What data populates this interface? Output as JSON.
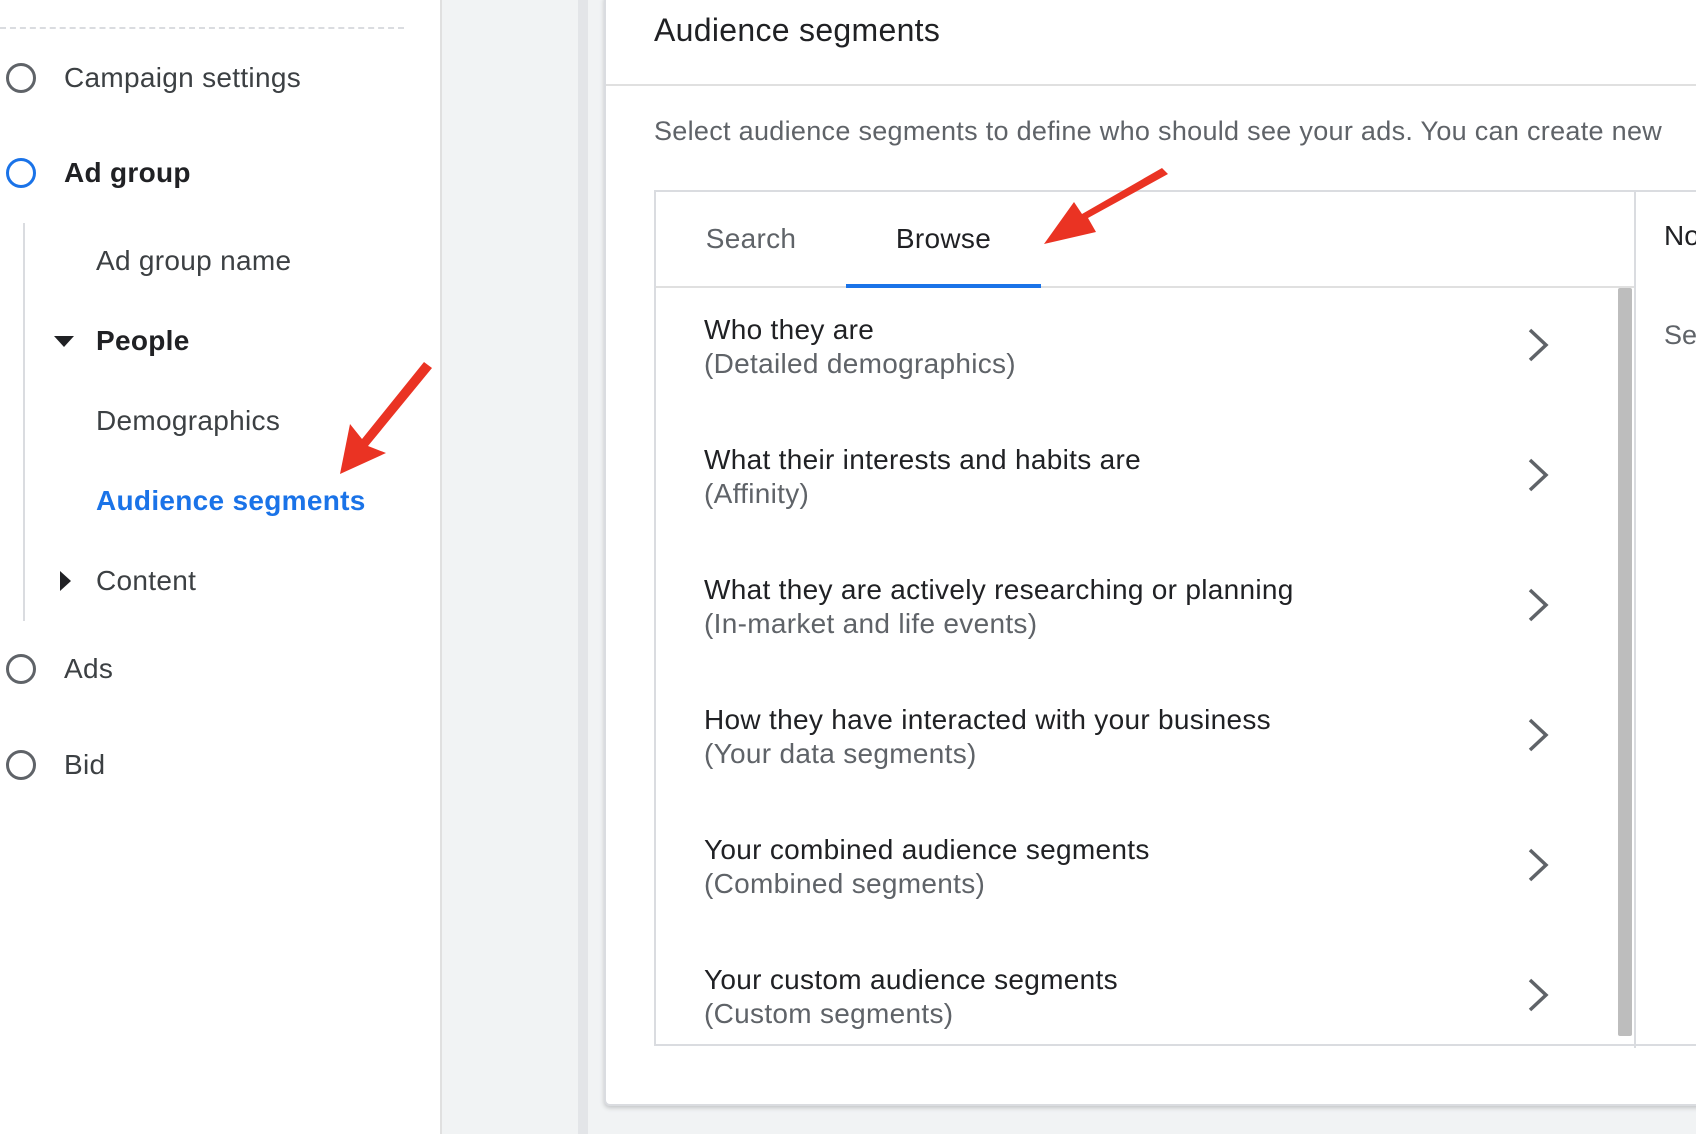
{
  "sidebar": {
    "steps": [
      {
        "label": "Campaign settings"
      },
      {
        "label": "Ad group"
      },
      {
        "label": "Ads"
      },
      {
        "label": "Bid"
      }
    ],
    "ad_group_children": {
      "ad_group_name": "Ad group name",
      "people": "People",
      "demographics": "Demographics",
      "audience_segments": "Audience segments",
      "content": "Content"
    }
  },
  "panel": {
    "title": "Audience segments",
    "description": "Select audience segments to define who should see your ads. You can create new",
    "tabs": [
      {
        "label": "Search",
        "selected": false
      },
      {
        "label": "Browse",
        "selected": true
      }
    ],
    "right_header": "No",
    "right_sub": "Sel",
    "categories": [
      {
        "title": "Who they are",
        "subtitle": "(Detailed demographics)"
      },
      {
        "title": "What their interests and habits are",
        "subtitle": "(Affinity)"
      },
      {
        "title": "What they are actively researching or planning",
        "subtitle": "(In-market and life events)"
      },
      {
        "title": "How they have interacted with your business",
        "subtitle": "(Your data segments)"
      },
      {
        "title": "Your combined audience segments",
        "subtitle": "(Combined segments)"
      },
      {
        "title": "Your custom audience segments",
        "subtitle": "(Custom segments)"
      }
    ]
  },
  "colors": {
    "accent": "#1a73e8",
    "annotation_arrow": "#ea3323"
  },
  "icons": [
    "circle-step-icon",
    "caret-down-icon",
    "caret-right-icon",
    "chevron-right-icon",
    "annotation-arrow-icon"
  ]
}
